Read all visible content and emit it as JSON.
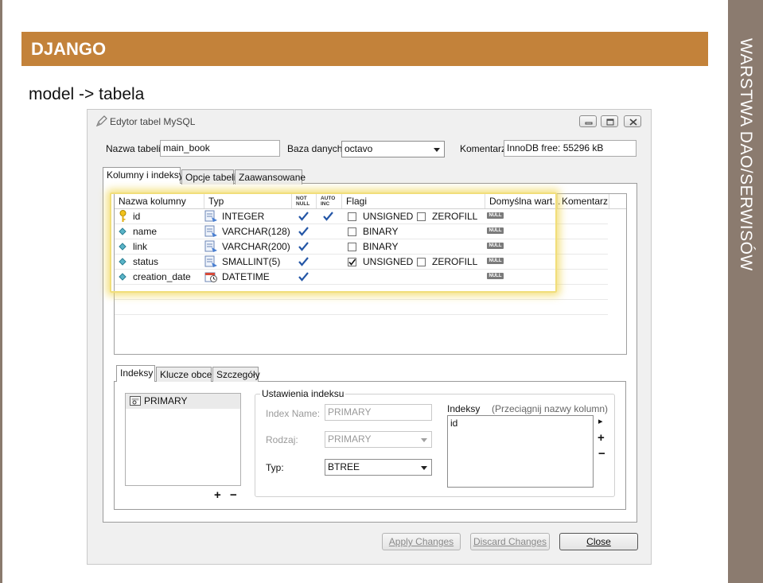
{
  "slide": {
    "banner_title": "DJANGO",
    "subtitle": "model -> tabela",
    "sidebar_title": "WARSTWA DAO/SERWISÓW"
  },
  "window": {
    "title": "Edytor tabel MySQL",
    "table_name_label": "Nazwa tabeli:",
    "table_name_value": "main_book",
    "database_label": "Baza danych:",
    "database_value": "octavo",
    "comment_label": "Komentarz:",
    "comment_value": "InnoDB free: 55296 kB",
    "tabs": [
      "Kolumny i indeksy",
      "Opcje tabeli",
      "Zaawansowane"
    ],
    "columns_table": {
      "headers": {
        "name": "Nazwa kolumny",
        "type": "Typ",
        "not_null_1": "NOT",
        "not_null_2": "NULL",
        "auto_inc_1": "AUTO",
        "auto_inc_2": "INC",
        "flags": "Flagi",
        "default": "Domyślna wart...",
        "comment": "Komentarz"
      },
      "null_badge": "NULL",
      "rows": [
        {
          "name": "id",
          "type": "INTEGER",
          "flag1": "UNSIGNED",
          "flag2": "ZEROFILL"
        },
        {
          "name": "name",
          "type": "VARCHAR(128)",
          "flag1": "BINARY"
        },
        {
          "name": "link",
          "type": "VARCHAR(200)",
          "flag1": "BINARY"
        },
        {
          "name": "status",
          "type": "SMALLINT(5)",
          "flag1": "UNSIGNED",
          "flag2": "ZEROFILL"
        },
        {
          "name": "creation_date",
          "type": "DATETIME"
        }
      ]
    },
    "lower_tabs": [
      "Indeksy",
      "Klucze obce",
      "Szczegóły"
    ],
    "index_list": [
      "PRIMARY"
    ],
    "add_symbol": "+",
    "remove_symbol": "−",
    "index_settings": {
      "group_label": "Ustawienia indeksu",
      "index_name_label": "Index Name:",
      "index_name_value": "PRIMARY",
      "kind_label": "Rodzaj:",
      "kind_value": "PRIMARY",
      "type_label": "Typ:",
      "type_value": "BTREE",
      "indexes_label": "Indeksy",
      "indexes_hint": "(Przeciągnij nazwy kolumn)",
      "index_columns": [
        "id"
      ],
      "arrow_symbol": "▸"
    },
    "buttons": {
      "apply": "Apply Changes",
      "discard": "Discard Changes",
      "close": "Close"
    }
  }
}
